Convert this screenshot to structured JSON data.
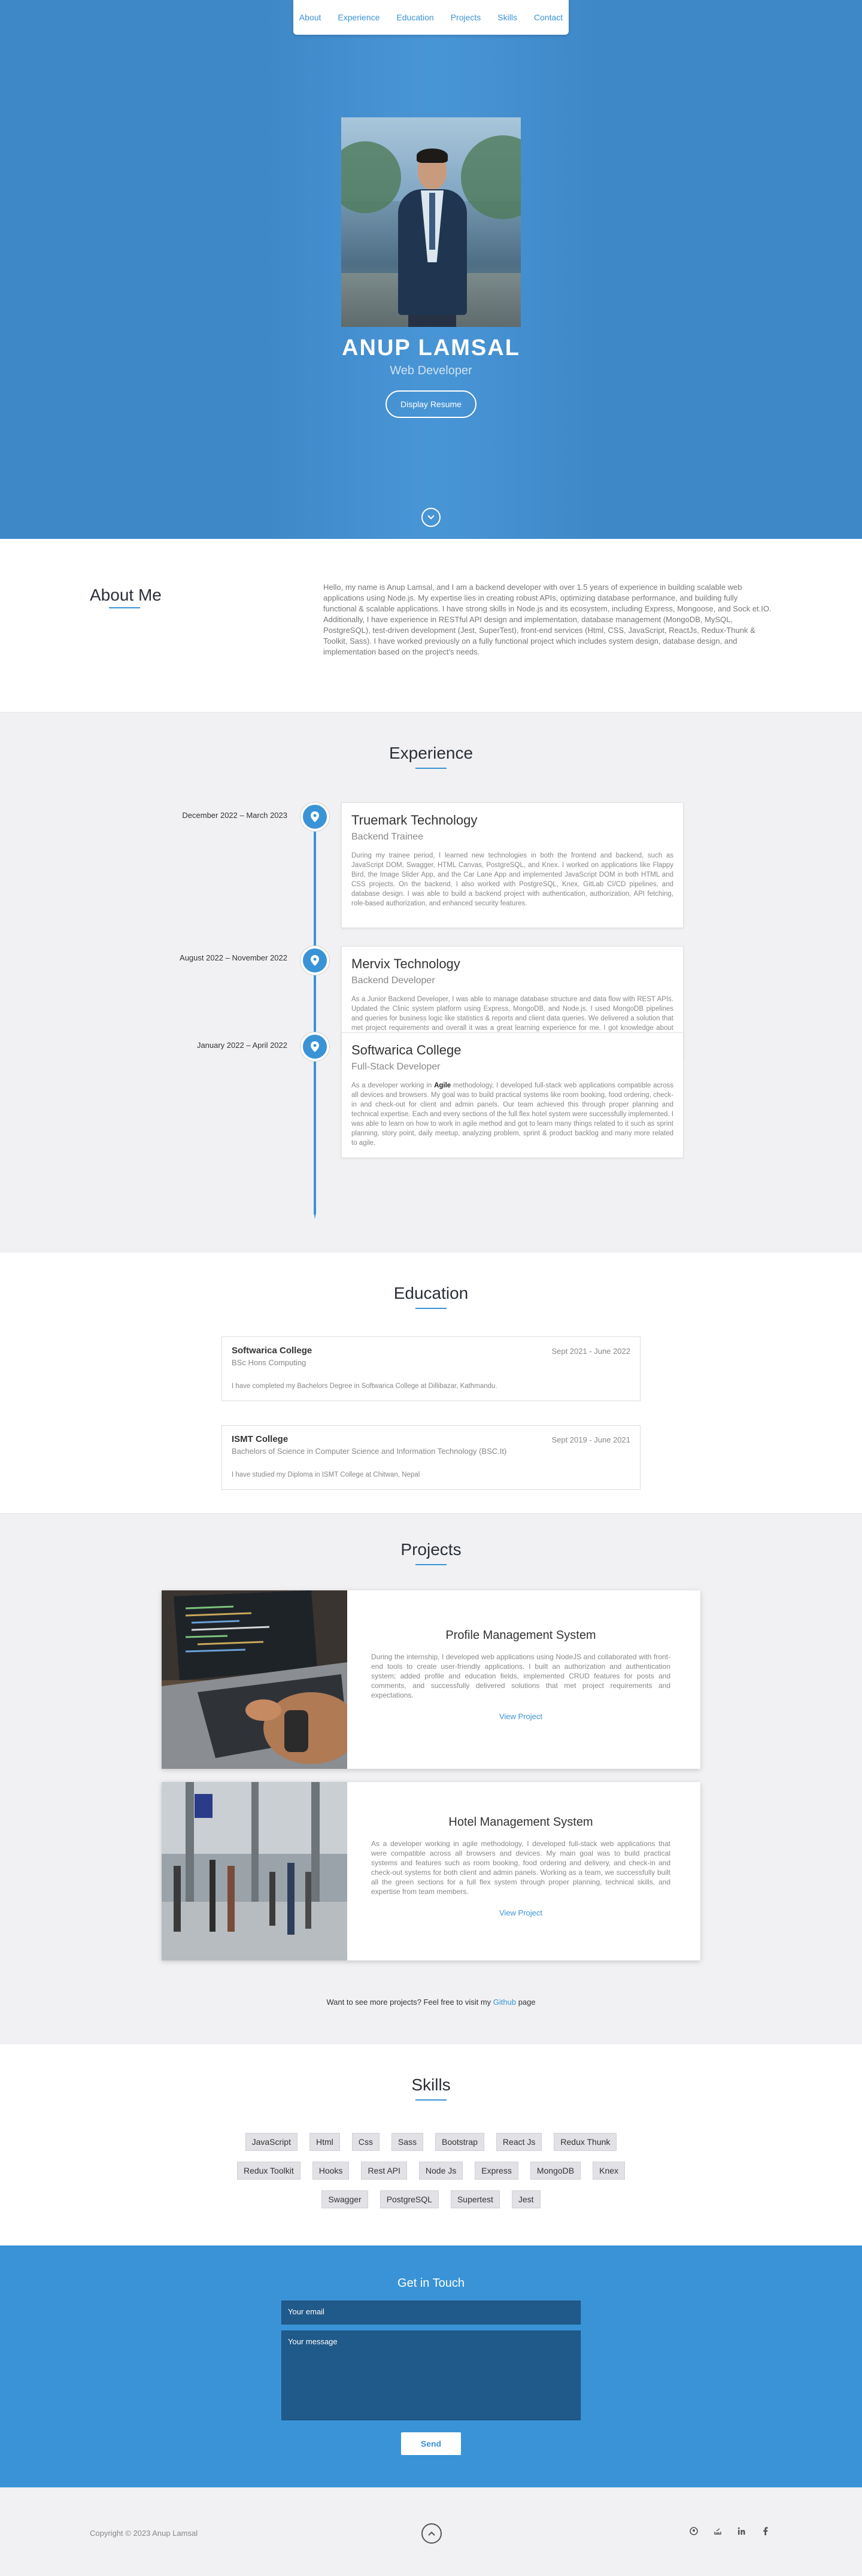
{
  "nav": {
    "items": [
      "About",
      "Experience",
      "Education",
      "Projects",
      "Skills",
      "Contact"
    ]
  },
  "hero": {
    "name": "ANUP LAMSAL",
    "role": "Web Developer",
    "resume_button": "Display Resume",
    "down_icon": "chevron-down-icon"
  },
  "about": {
    "title": "About Me",
    "text": "Hello, my name is Anup Lamsal, and I am a backend developer with over 1.5 years of experience in building scalable web applications using Node.js. My expertise lies in creating robust APIs, optimizing database performance, and building fully functional & scalable applications. I have strong skills in Node.js and its ecosystem, including Express, Mongoose, and Sock et.IO. Additionally, I have experience in RESTful API design and implementation, database management (MongoDB, MySQL, PostgreSQL), test-driven development (Jest, SuperTest), front-end services (Html, CSS, JavaScript, ReactJs, Redux-Thunk & Toolkit, Sass). I have worked previously on a fully functional project which includes system design, database design, and implementation based on the project's needs."
  },
  "experience": {
    "title": "Experience",
    "items": [
      {
        "date": "December 2022 – March 2023",
        "company": "Truemark Technology",
        "role": "Backend Trainee",
        "desc": "During my trainee period, I learned new technologies in both the frontend and backend, such as JavaScript DOM, Swagger, HTML Canvas, PostgreSQL, and Knex. I worked on applications like Flappy Bird, the Image Slider App, and the Car Lane App and implemented JavaScript DOM in both HTML and CSS projects. On the backend, I also worked with PostgreSQL, Knex, GitLab CI/CD pipelines, and database design. I was able to build a backend project with authentication, authorization, API fetching, role-based authorization, and enhanced security features."
      },
      {
        "date": "August 2022 – November 2022",
        "company": "Mervix Technology",
        "role": "Backend Developer",
        "desc": "As a Junior Backend Developer, I was able to manage database structure and data flow with REST APIs. Updated the Clinic system platform using Express, MongoDB, and Node.js. I used MongoDB pipelines and queries for business logic like statistics & reports and client data queries. We delivered a solution that met project requirements and overall it was a great learning experience for me. I got knowledge about how to work in a company and working on their policy. I got to make myself more productive and think more strategically."
      },
      {
        "date": "January 2022 – April 2022",
        "company": "Softwarica College",
        "role": "Full-Stack Developer",
        "desc_before": "As a developer working in ",
        "desc_bold": "Agile",
        "desc_after": " methodology, I developed full-stack web applications compatible across all devices and browsers. My goal was to build practical systems like room booking, food ordering, check-in and check-out for client and admin panels. Our team achieved this through proper planning and technical expertise. Each and every sections of the full flex hotel system were successfully implemented. I was able to learn on how to work in agile method and got to learn many things related to it such as sprint planning, story point, daily meetup, analyzing problem, sprint & product backlog and many more related to agile."
      }
    ]
  },
  "education": {
    "title": "Education",
    "items": [
      {
        "school": "Softwarica College",
        "degree": "BSc Hons Computing",
        "period": "Sept 2021 - June 2022",
        "desc": "I have completed my Bachelors Degree in Softwarica College at Dillibazar, Kathmandu."
      },
      {
        "school": "ISMT College",
        "degree": "Bachelors of Science in Computer Science and Information Technology (BSC.It)",
        "period": "Sept 2019 - June 2021",
        "desc": "I have studied my Diploma in ISMT College at Chitwan, Nepal"
      }
    ]
  },
  "projects": {
    "title": "Projects",
    "items": [
      {
        "title": "Profile Management System",
        "desc": "During the internship, I developed web applications using NodeJS and collaborated with front-end tools to create user-friendly applications. I built an authorization and authentication system; added profile and education fields, implemented CRUD features for posts and comments, and successfully delivered solutions that met project requirements and expectations.",
        "link": "View Project"
      },
      {
        "title": "Hotel Management System",
        "desc": "As a developer working in agile methodology, I developed full-stack web applications that were compatible across all browsers and devices. My main goal was to build practical systems and features such as room booking, food ordering and delivery, and check-in and check-out systems for both client and admin panels. Working as a team, we successfully built all the green sections for a full flex system through proper planning, technical skills, and expertise from team members.",
        "link": "View Project"
      }
    ],
    "more_before": "Want to see more projects? Feel free to visit my ",
    "more_link": "Github",
    "more_after": " page"
  },
  "skills": {
    "title": "Skills",
    "rows": [
      [
        "JavaScript",
        "Html",
        "Css",
        "Sass",
        "Bootstrap",
        "React Js",
        "Redux Thunk"
      ],
      [
        "Redux Toolkit",
        "Hooks",
        "Rest API",
        "Node Js",
        "Express",
        "MongoDB",
        "Knex"
      ],
      [
        "Swagger",
        "PostgreSQL",
        "Supertest",
        "Jest"
      ]
    ]
  },
  "contact": {
    "title": "Get in Touch",
    "email_placeholder": "Your email",
    "message_placeholder": "Your message",
    "send_label": "Send"
  },
  "footer": {
    "copyright": "Copyright © 2023 Anup Lamsal",
    "socials": [
      "github-icon",
      "stackoverflow-icon",
      "linkedin-icon",
      "facebook-icon"
    ]
  },
  "colors": {
    "accent": "#3a93d6",
    "hero_bg": "#3f88c8"
  }
}
